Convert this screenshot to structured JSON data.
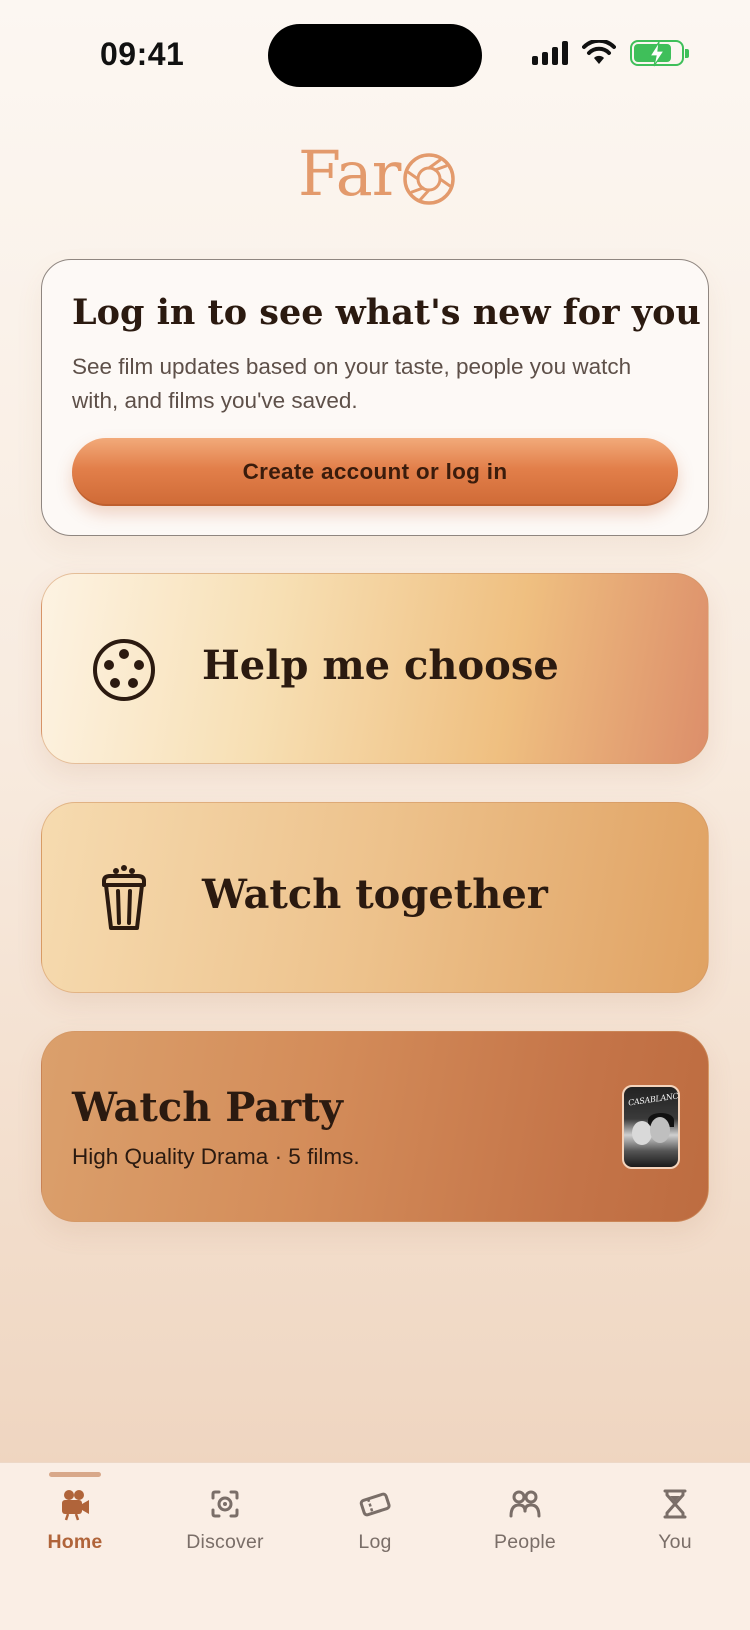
{
  "status_bar": {
    "time": "09:41"
  },
  "logo": {
    "text": "Far"
  },
  "login_card": {
    "title": "Log in to see what's new for you",
    "description": "See film updates based on your taste, people you watch with, and films you've saved.",
    "button_label": "Create account or log in"
  },
  "actions": {
    "help_choose": {
      "label": "Help me choose",
      "icon": "film-reel-icon"
    },
    "watch_together": {
      "label": "Watch together",
      "icon": "popcorn-icon"
    }
  },
  "watch_party": {
    "title": "Watch Party",
    "subtitle": "High Quality Drama · 5 films.",
    "poster_title": "CASABLANCA"
  },
  "tabs": [
    {
      "label": "Home",
      "icon": "movie-camera-icon",
      "active": true
    },
    {
      "label": "Discover",
      "icon": "discover-icon",
      "active": false
    },
    {
      "label": "Log",
      "icon": "ticket-icon",
      "active": false
    },
    {
      "label": "People",
      "icon": "people-icon",
      "active": false
    },
    {
      "label": "You",
      "icon": "hourglass-icon",
      "active": false
    }
  ],
  "colors": {
    "accent": "#e27f4a",
    "active_tab": "#b0643a",
    "battery": "#3fbf5a"
  }
}
